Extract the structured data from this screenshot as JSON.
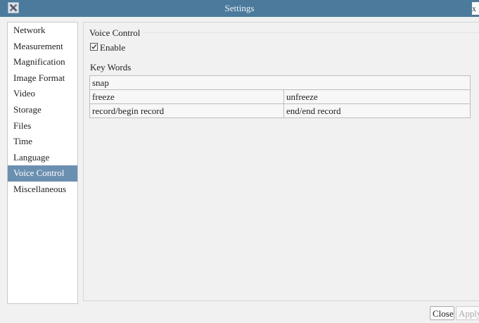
{
  "window": {
    "title": "Settings",
    "close_glyph": "x"
  },
  "sidebar": {
    "items": [
      {
        "label": "Network"
      },
      {
        "label": "Measurement"
      },
      {
        "label": "Magnification"
      },
      {
        "label": "Image Format"
      },
      {
        "label": "Video"
      },
      {
        "label": "Storage"
      },
      {
        "label": "Files"
      },
      {
        "label": "Time"
      },
      {
        "label": "Language"
      },
      {
        "label": "Voice Control",
        "selected": true
      },
      {
        "label": "Miscellaneous"
      }
    ]
  },
  "voice_control": {
    "group_title": "Voice Control",
    "enable_label": "Enable",
    "enable_checked": true,
    "keywords_label": "Key Words",
    "rows": [
      [
        "snap"
      ],
      [
        "freeze",
        "unfreeze"
      ],
      [
        "record/begin record",
        "end/end record"
      ]
    ]
  },
  "buttons": {
    "close": "Close",
    "apply": "Apply"
  },
  "colors": {
    "titlebar": "#4b7a9c",
    "selected_item": "#6b8fb0"
  }
}
